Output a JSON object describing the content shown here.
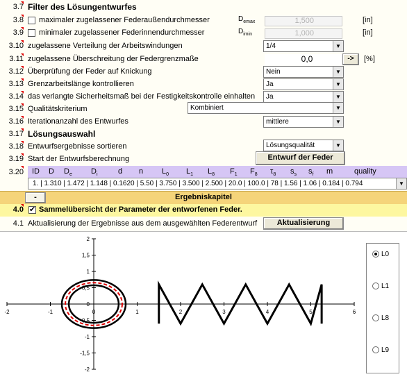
{
  "filter": {
    "num": "3.7",
    "title": "Filter des Lösungentwurfes",
    "r38": {
      "num": "3.8",
      "label": "maximaler zugelassener Federaußendurchmesser",
      "sym": "D",
      "sub": "emax",
      "value": "1,500",
      "unit": "[in]"
    },
    "r39": {
      "num": "3.9",
      "label": "minimaler zugelassener Federinnendurchmesser",
      "sym": "D",
      "sub": "imin",
      "value": "1,000",
      "unit": "[in]"
    },
    "r310": {
      "num": "3.10",
      "label": "zugelassene Verteilung der Arbeitswindungen",
      "value": "1/4"
    },
    "r311": {
      "num": "3.11",
      "label": "zugelassene Überschreitung der Federgrenzmaße",
      "value": "0,0",
      "button": "->",
      "unit": "[%]"
    },
    "r312": {
      "num": "3.12",
      "label": "Überprüfung der Feder auf Knickung",
      "value": "Nein"
    },
    "r313": {
      "num": "3.13",
      "label": "Grenzarbeitslänge kontrollieren",
      "value": "Ja"
    },
    "r314": {
      "num": "3.14",
      "label": "das verlangte Sicherheitsmaß bei der Festigkeitskontrolle einhalten",
      "value": "Ja"
    },
    "r315": {
      "num": "3.15",
      "label": "Qualitätskriterium",
      "value": "Kombiniert"
    },
    "r316": {
      "num": "3.16",
      "label": "Iterationanzahl des Entwurfes",
      "value": "mittlere"
    }
  },
  "loesung": {
    "num": "3.17",
    "title": "Lösungsauswahl",
    "r318": {
      "num": "3.18",
      "label": "Entwurfsergebnisse sortieren",
      "value": "Lösungsqualität"
    },
    "r319": {
      "num": "3.19",
      "label": "Start der Entwurfsberechnung",
      "button": "Entwurf der Feder"
    },
    "r320": {
      "num": "3.20"
    }
  },
  "table": {
    "headers": [
      {
        "t": "ID",
        "s": ""
      },
      {
        "t": "D",
        "s": ""
      },
      {
        "t": "D",
        "s": "e"
      },
      {
        "t": "D",
        "s": "i"
      },
      {
        "t": "d",
        "s": ""
      },
      {
        "t": "n",
        "s": ""
      },
      {
        "t": "L",
        "s": "0"
      },
      {
        "t": "L",
        "s": "1"
      },
      {
        "t": "L",
        "s": "8"
      },
      {
        "t": "F",
        "s": "1"
      },
      {
        "t": "F",
        "s": "8"
      },
      {
        "t": "τ",
        "s": "8"
      },
      {
        "t": "s",
        "s": "s"
      },
      {
        "t": "s",
        "s": "f"
      },
      {
        "t": "m",
        "s": ""
      },
      {
        "t": "quality",
        "s": ""
      }
    ],
    "row": "1. | 1.310 | 1.472 | 1.148 | 0.1620 | 5.50 | 3.750 | 3.500 | 2.500 | 20.0 | 100.0 | 78 | 1.56 | 1.06 | 0.184 | 0.794"
  },
  "kapitel": {
    "collapse": "-",
    "title": "Ergebniskapitel"
  },
  "sammel": {
    "num": "4.0",
    "label": "Sammelübersicht der Parameter der entworfenen Feder."
  },
  "aktual": {
    "num": "4.1",
    "label": "Aktualisierung der Ergebnisse aus dem ausgewählten Federentwurf",
    "button": "Aktualisierung"
  },
  "chart_data": {
    "type": "line",
    "xlim": [
      -2,
      6
    ],
    "ylim": [
      -2,
      2
    ],
    "x_ticks": [
      "-2",
      "-1",
      "0",
      "1",
      "2",
      "3",
      "4",
      "5",
      "6"
    ],
    "y_ticks": [
      "2",
      "1,5",
      "1",
      "0,5",
      "0",
      "-0,5",
      "-1",
      "-1,5",
      "-2"
    ],
    "outer_diameter": 1.472,
    "inner_diameter": 1.148,
    "mean_diameter": 1.31,
    "spring_x": [
      1.5,
      1.5,
      2,
      2.5,
      3,
      3.5,
      4,
      4.5,
      5,
      5.25,
      5.25
    ],
    "spring_y": [
      -0.6,
      0.6,
      -0.6,
      0.6,
      -0.6,
      0.6,
      -0.6,
      0.6,
      -0.6,
      0.6,
      -0.6
    ],
    "legend": [
      "L0",
      "L1",
      "L8",
      "L9"
    ],
    "selected": "L0"
  }
}
